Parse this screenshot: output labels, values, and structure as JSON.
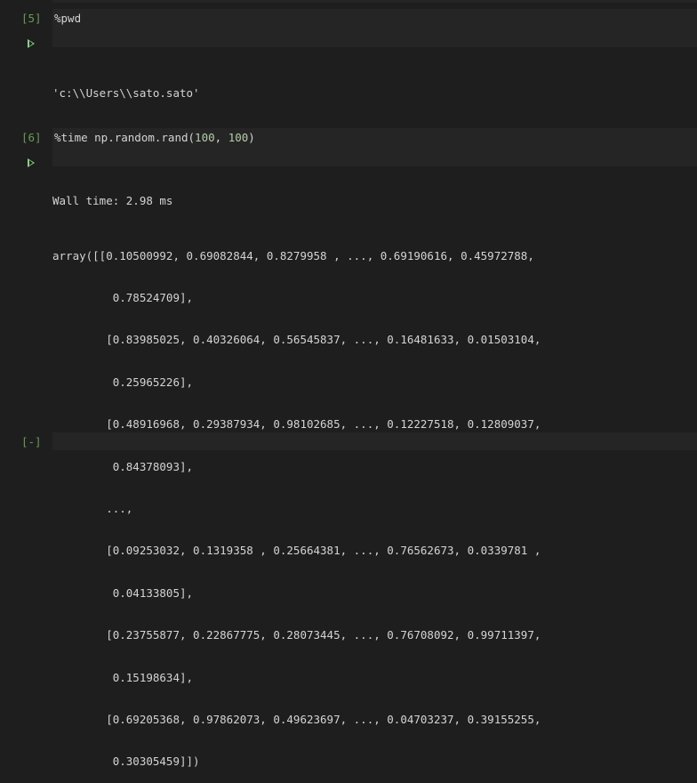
{
  "cells": [
    {
      "prompt": "[5]",
      "source": "%pwd",
      "output": "'c:\\\\Users\\\\sato.sato'"
    },
    {
      "prompt": "[6]",
      "source_prefix": "%time np.random.rand(",
      "source_arg1": "100",
      "source_sep": ", ",
      "source_arg2": "100",
      "source_suffix": ")",
      "wall_time": "Wall time: 2.98 ms",
      "output_lines": [
        "array([[0.10500992, 0.69082844, 0.8279958 , ..., 0.69190616, 0.45972788,",
        "         0.78524709],",
        "        [0.83985025, 0.40326064, 0.56545837, ..., 0.16481633, 0.01503104,",
        "         0.25965226],",
        "        [0.48916968, 0.29387934, 0.98102685, ..., 0.12227518, 0.12809037,",
        "         0.84378093],",
        "        ...,",
        "        [0.09253032, 0.1319358 , 0.25664381, ..., 0.76562673, 0.0339781 ,",
        "         0.04133805],",
        "        [0.23755877, 0.22867775, 0.28073445, ..., 0.76708092, 0.99711397,",
        "         0.15198634],",
        "        [0.69205368, 0.97862073, 0.49623697, ..., 0.04703237, 0.39155255,",
        "         0.30305459]])"
      ]
    },
    {
      "prompt": "[-]"
    }
  ]
}
